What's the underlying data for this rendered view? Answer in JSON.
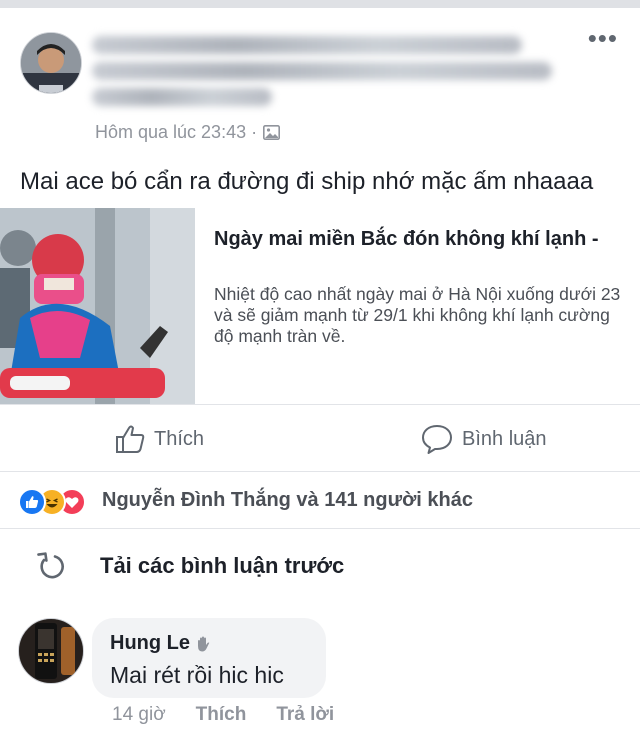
{
  "post": {
    "timestamp": "Hôm qua lúc 23:43 ·",
    "more_label": "•••",
    "status": "Mai ace bó cẩn ra đường đi ship nhớ mặc ấm nhaaaa",
    "privacy_icon": "photo-privacy-icon"
  },
  "link_card": {
    "title": "Ngày mai miền Bắc đón không khí lạnh -",
    "description": "Nhiệt độ cao nhất ngày mai ở Hà Nội xuống dưới 23 và sẽ giảm mạnh từ 29/1 khi không khí lạnh cường độ mạnh tràn về."
  },
  "actions": {
    "like": "Thích",
    "comment": "Bình luận"
  },
  "reactions": {
    "text": "Nguyễn Đình Thắng và 141 người khác",
    "icons": [
      "like-reaction-icon",
      "haha-reaction-icon",
      "love-reaction-icon"
    ],
    "colors": {
      "like": "#1877f2",
      "haha": "#f7b125",
      "love": "#f33e58"
    }
  },
  "comments": {
    "load_previous": "Tải các bình luận trước",
    "items": [
      {
        "author": "Hung Le",
        "text": "Mai rét rồi hic hic",
        "time": "14 giờ",
        "like_label": "Thích",
        "reply_label": "Trả lời"
      }
    ]
  }
}
